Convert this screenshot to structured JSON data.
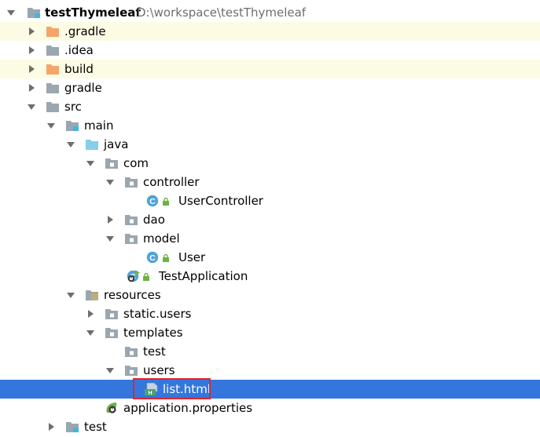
{
  "project_tree": {
    "root": {
      "name": "testThymeleaf",
      "path": "D:\\workspace\\testThymeleaf"
    },
    "items": [
      {
        "label": ".gradle"
      },
      {
        "label": ".idea"
      },
      {
        "label": "build"
      },
      {
        "label": "gradle"
      },
      {
        "label": "src"
      },
      {
        "label": "main"
      },
      {
        "label": "java"
      },
      {
        "label": "com"
      },
      {
        "label": "controller"
      },
      {
        "label": "UserController"
      },
      {
        "label": "dao"
      },
      {
        "label": "model"
      },
      {
        "label": "User"
      },
      {
        "label": "TestApplication"
      },
      {
        "label": "resources"
      },
      {
        "label": "static.users"
      },
      {
        "label": "templates"
      },
      {
        "label": "test"
      },
      {
        "label": "users"
      },
      {
        "label": "list.html"
      },
      {
        "label": "application.properties"
      },
      {
        "label": "test"
      }
    ]
  },
  "icons": {
    "folder": "folder-icon",
    "package": "package-icon",
    "class": "java-class-icon",
    "spring_boot": "spring-boot-icon",
    "html": "html-file-icon",
    "properties": "spring-properties-icon"
  },
  "colors": {
    "selection": "#3476dc",
    "excluded_row": "#fcfbe3",
    "excluded_folder": "#f5a56a",
    "folder": "#9aa7b0",
    "source_folder": "#87cee9",
    "class_icon": "#4ea4d8",
    "spring_green": "#6db33f",
    "highlight_border": "#e0262d"
  }
}
